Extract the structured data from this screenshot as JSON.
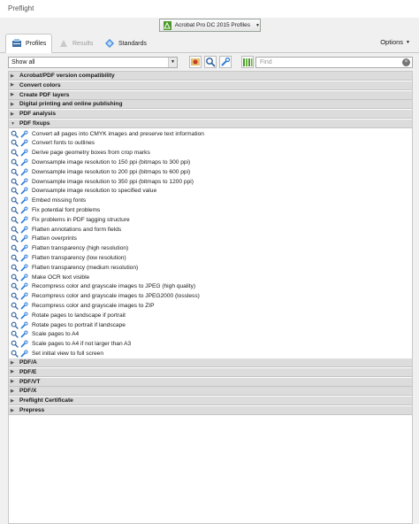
{
  "window": {
    "title": "Preflight"
  },
  "profile_selector": {
    "label": "Acrobat Pro DC 2015 Profiles"
  },
  "tabs": [
    {
      "label": "Profiles",
      "active": true,
      "icon": "profiles-icon"
    },
    {
      "label": "Results",
      "active": false,
      "disabled": true,
      "icon": "results-icon"
    },
    {
      "label": "Standards",
      "active": false,
      "icon": "standards-icon"
    }
  ],
  "options_label": "Options",
  "toolbar": {
    "show_value": "Show all",
    "find_placeholder": "Find",
    "buttons": [
      "edit-profile-icon",
      "magnify-icon",
      "wrench-icon",
      "library-icon"
    ]
  },
  "categories_top": [
    {
      "label": "Acrobat/PDF version compatibility"
    },
    {
      "label": "Convert colors"
    },
    {
      "label": "Create PDF layers"
    },
    {
      "label": "Digital printing and online publishing"
    },
    {
      "label": "PDF analysis"
    },
    {
      "label": "PDF fixups",
      "expanded": true
    }
  ],
  "fixups": [
    "Convert all pages into CMYK images and preserve text information",
    "Convert fonts to outlines",
    "Derive page geometry boxes from crop marks",
    "Downsample image resolution to 150 ppi (bitmaps to 300 ppi)",
    "Downsample image resolution to 200 ppi (bitmaps to 600 ppi)",
    "Downsample image resolution to 350 ppi (bitmaps to 1200 ppi)",
    "Downsample image resolution to specified value",
    "Embed missing fonts",
    "Fix potential font problems",
    "Fix problems in PDF tagging structure",
    "Flatten annotations and form fields",
    "Flatten overprints",
    "Flatten transparency (high resolution)",
    "Flatten transparency (low resolution)",
    "Flatten transparency (medium resolution)",
    "Make OCR text visible",
    "Recompress color and grayscale images to JPEG (high quality)",
    "Recompress color and grayscale images to JPEG2000 (lossless)",
    "Recompress color and grayscale images to ZIP",
    "Rotate pages to landscape if portrait",
    "Rotate pages to portrait if landscape",
    "Scale pages to A4",
    "Scale pages to A4 if not larger than A3",
    "Set initial view to full screen"
  ],
  "categories_bottom": [
    {
      "label": "PDF/A"
    },
    {
      "label": "PDF/E"
    },
    {
      "label": "PDF/VT"
    },
    {
      "label": "PDF/X"
    },
    {
      "label": "Preflight Certificate"
    },
    {
      "label": "Prepress"
    }
  ],
  "colors": {
    "accent_green": "#4c9a2a",
    "category_bg": "#dcdcdc"
  }
}
